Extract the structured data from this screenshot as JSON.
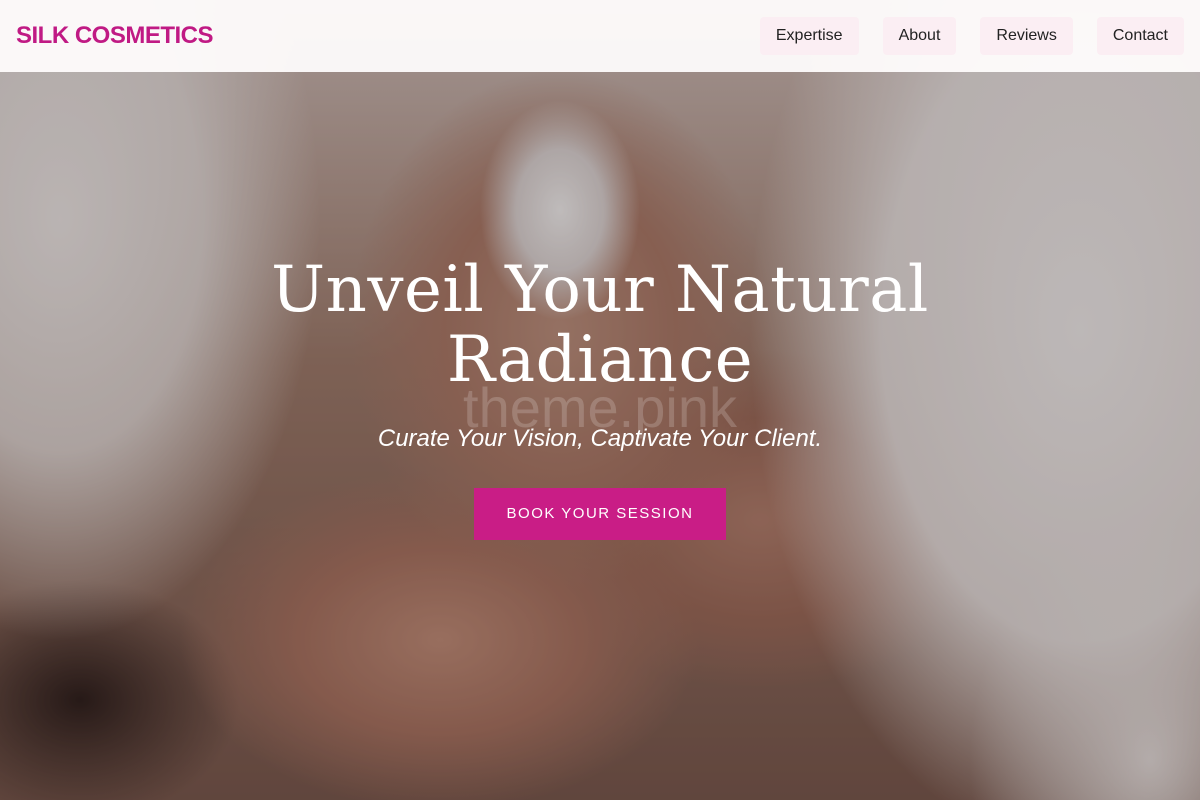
{
  "brand": {
    "name": "SILK COSMETICS"
  },
  "nav": {
    "items": [
      {
        "label": "Expertise"
      },
      {
        "label": "About"
      },
      {
        "label": "Reviews"
      },
      {
        "label": "Contact"
      }
    ]
  },
  "hero": {
    "title": "Unveil Your Natural Radiance",
    "watermark": "theme.pink",
    "subtitle": "Curate Your Vision, Captivate Your Client.",
    "cta_label": "BOOK YOUR SESSION"
  },
  "colors": {
    "brand": "#c01a84",
    "cta_background": "#c91d86",
    "nav_item_background": "#fbeef3",
    "text_on_hero": "#ffffff"
  }
}
